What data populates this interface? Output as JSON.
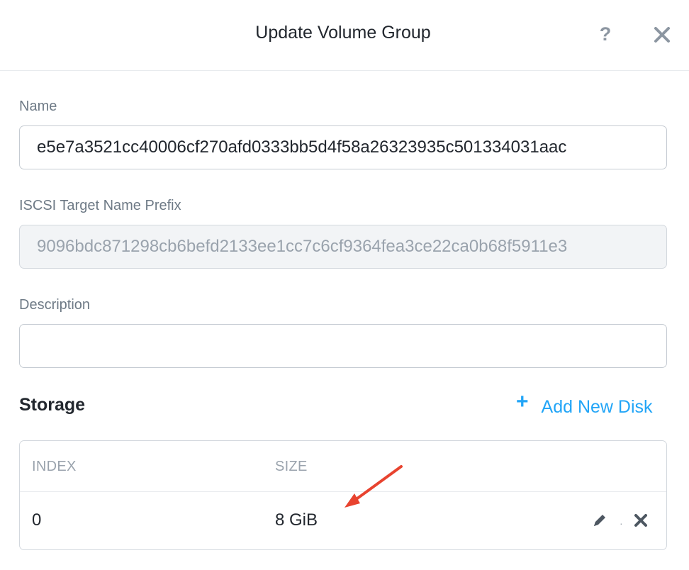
{
  "dialog": {
    "title": "Update Volume Group",
    "help_label": "?"
  },
  "form": {
    "name": {
      "label": "Name",
      "value": "e5e7a3521cc40006cf270afd0333bb5d4f58a26323935c501334031aac"
    },
    "iscsi": {
      "label": "ISCSI Target Name Prefix",
      "value": "9096bdc871298cb6befd2133ee1cc7c6cf9364fea3ce22ca0b68f5911e3"
    },
    "description": {
      "label": "Description",
      "value": ""
    }
  },
  "storage": {
    "title": "Storage",
    "add_disk_icon": "+",
    "add_disk_label": "Add New Disk",
    "columns": [
      "INDEX",
      "SIZE"
    ],
    "rows": [
      {
        "index": "0",
        "size": "8 GiB"
      }
    ],
    "row_separator": "·"
  },
  "colors": {
    "accent": "#22a5f7",
    "annotation_arrow": "#e8432f",
    "label": "#6e7a86",
    "muted": "#9aa3ad"
  },
  "icons": {
    "close": "close-icon",
    "help": "help-icon",
    "edit": "pencil-icon",
    "delete": "delete-x-icon",
    "add": "plus-icon"
  }
}
